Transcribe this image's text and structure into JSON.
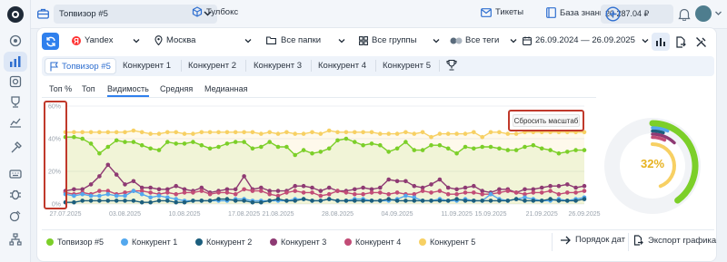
{
  "topbar": {
    "project_label": "Топвизор #5",
    "toolbox_label": "Тулбокс",
    "tickets_label": "Тикеты",
    "kb_label": "База знаний",
    "balance": "20 287.04 ₽"
  },
  "filters": {
    "search_engine": "Yandex",
    "region": "Москва",
    "folders": "Все папки",
    "groups": "Все группы",
    "tags": "Все теги",
    "date_range": "26.09.2024 — 26.09.2025"
  },
  "tabs": [
    "Топвизор #5",
    "Конкурент 1",
    "Конкурент 2",
    "Конкурент 3",
    "Конкурент 4",
    "Конкурент 5"
  ],
  "subtabs": [
    "Топ %",
    "Топ",
    "Видимость",
    "Средняя",
    "Медианная"
  ],
  "reset_zoom_label": "Сбросить масштаб",
  "donut_value": "32%",
  "legend": [
    {
      "name": "Топвизор #5",
      "color": "#7ccf29"
    },
    {
      "name": "Конкурент 1",
      "color": "#53a8ee"
    },
    {
      "name": "Конкурент 2",
      "color": "#1c5e7d"
    },
    {
      "name": "Конкурент 3",
      "color": "#8e3a73"
    },
    {
      "name": "Конкурент 4",
      "color": "#c24c76"
    },
    {
      "name": "Конкурент 5",
      "color": "#f7d063"
    }
  ],
  "actions": {
    "date_order": "Порядок дат",
    "export": "Экспорт графика"
  },
  "chart_data": {
    "type": "line",
    "x": [
      "27.07.2025",
      "28.07.2025",
      "29.07.2025",
      "30.07.2025",
      "31.07.2025",
      "01.08.2025",
      "02.08.2025",
      "03.08.2025",
      "04.08.2025",
      "05.08.2025",
      "06.08.2025",
      "07.08.2025",
      "08.08.2025",
      "09.08.2025",
      "10.08.2025",
      "11.08.2025",
      "12.08.2025",
      "13.08.2025",
      "14.08.2025",
      "15.08.2025",
      "16.08.2025",
      "17.08.2025",
      "18.08.2025",
      "19.08.2025",
      "20.08.2025",
      "21.08.2025",
      "22.08.2025",
      "23.08.2025",
      "24.08.2025",
      "25.08.2025",
      "26.08.2025",
      "27.08.2025",
      "28.08.2025",
      "29.08.2025",
      "30.08.2025",
      "31.08.2025",
      "01.09.2025",
      "02.09.2025",
      "03.09.2025",
      "04.09.2025",
      "05.09.2025",
      "06.09.2025",
      "07.09.2025",
      "08.09.2025",
      "09.09.2025",
      "10.09.2025",
      "11.09.2025",
      "12.09.2025",
      "13.09.2025",
      "14.09.2025",
      "15.09.2025",
      "16.09.2025",
      "17.09.2025",
      "18.09.2025",
      "19.09.2025",
      "20.09.2025",
      "21.09.2025",
      "22.09.2025",
      "23.09.2025",
      "24.09.2025",
      "25.09.2025",
      "26.09.2025"
    ],
    "x_ticks": [
      "27.07.2025",
      "03.08.2025",
      "10.08.2025",
      "17.08.2025",
      "21.08.2025",
      "28.08.2025",
      "04.09.2025",
      "11.09.2025",
      "15.09.2025",
      "21.09.2025",
      "26.09.2025"
    ],
    "y_ticks": [
      "0%",
      "20%",
      "40%",
      "60%"
    ],
    "ylim": [
      0,
      60
    ],
    "grid": true,
    "series": [
      {
        "name": "Топвизор #5",
        "values": [
          41,
          41,
          40,
          37,
          31,
          35,
          39,
          38,
          38,
          36,
          34,
          33,
          38,
          37,
          37,
          38,
          36,
          34,
          35,
          37,
          38,
          38,
          34,
          35,
          38,
          35,
          35,
          30,
          33,
          31,
          32,
          34,
          39,
          40,
          38,
          36,
          37,
          36,
          32,
          34,
          38,
          33,
          33,
          36,
          36,
          34,
          31,
          35,
          34,
          35,
          35,
          34,
          33,
          33,
          35,
          36,
          34,
          33,
          31,
          32,
          33,
          33
        ]
      },
      {
        "name": "Конкурент 1",
        "values": [
          6,
          5,
          6,
          5,
          5,
          6,
          5,
          5,
          8,
          6,
          4,
          5,
          4,
          3,
          2,
          2,
          2,
          2,
          2,
          2,
          3,
          3,
          2,
          2,
          2,
          2,
          2,
          3,
          3,
          2,
          2,
          3,
          2,
          2,
          3,
          3,
          2,
          2,
          2,
          3,
          5,
          4,
          2,
          2,
          3,
          2,
          2,
          3,
          2,
          2,
          6,
          3,
          2,
          3,
          4,
          3,
          2,
          2,
          3,
          2,
          3,
          4
        ]
      },
      {
        "name": "Конкурент 2",
        "values": [
          1,
          1,
          2,
          2,
          2,
          2,
          2,
          2,
          2,
          1,
          1,
          2,
          2,
          1,
          1,
          2,
          2,
          2,
          3,
          3,
          2,
          2,
          1,
          1,
          2,
          3,
          2,
          2,
          3,
          2,
          2,
          3,
          2,
          2,
          2,
          2,
          2,
          2,
          3,
          2,
          2,
          2,
          2,
          2,
          2,
          2,
          3,
          2,
          2,
          2,
          2,
          2,
          2,
          3,
          2,
          2,
          2,
          3,
          2,
          2,
          2,
          3
        ]
      },
      {
        "name": "Конкурент 3",
        "values": [
          8,
          9,
          9,
          12,
          17,
          24,
          18,
          12,
          14,
          10,
          10,
          9,
          9,
          11,
          9,
          8,
          10,
          7,
          8,
          9,
          9,
          17,
          9,
          10,
          8,
          8,
          8,
          11,
          11,
          10,
          8,
          10,
          8,
          8,
          9,
          10,
          9,
          10,
          15,
          14,
          14,
          11,
          10,
          12,
          15,
          10,
          9,
          10,
          11,
          8,
          7,
          9,
          9,
          7,
          9,
          9,
          10,
          11,
          11,
          12,
          10,
          11
        ]
      },
      {
        "name": "Конкурент 4",
        "values": [
          7,
          6,
          7,
          6,
          8,
          8,
          6,
          7,
          8,
          8,
          7,
          6,
          7,
          6,
          7,
          7,
          8,
          6,
          7,
          7,
          6,
          9,
          8,
          8,
          6,
          5,
          7,
          8,
          7,
          7,
          5,
          6,
          8,
          7,
          6,
          6,
          7,
          7,
          6,
          7,
          6,
          6,
          8,
          7,
          8,
          6,
          6,
          7,
          7,
          6,
          6,
          7,
          8,
          7,
          6,
          7,
          7,
          8,
          6,
          7,
          7,
          8
        ]
      },
      {
        "name": "Конкурент 5",
        "values": [
          44,
          44,
          44,
          44,
          44,
          44,
          44,
          44,
          45,
          44,
          43,
          43,
          44,
          44,
          43,
          43,
          44,
          44,
          44,
          44,
          44,
          44,
          44,
          43,
          44,
          43,
          44,
          43,
          43,
          44,
          43,
          45,
          44,
          44,
          44,
          44,
          44,
          43,
          43,
          43,
          44,
          43,
          44,
          41,
          43,
          43,
          43,
          43,
          44,
          41,
          44,
          44,
          43,
          43,
          44,
          44,
          44,
          44,
          44,
          44,
          44,
          44
        ]
      }
    ]
  }
}
